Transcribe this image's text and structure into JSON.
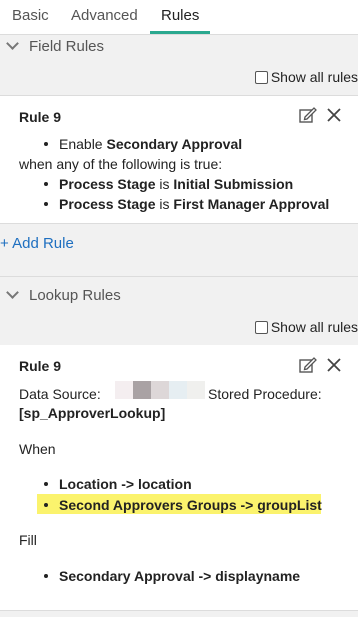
{
  "tabs": [
    {
      "label": "Basic",
      "active": false
    },
    {
      "label": "Advanced",
      "active": false
    },
    {
      "label": "Rules",
      "active": true
    }
  ],
  "field_rules": {
    "header": "Field Rules",
    "show_all_label": "Show all rules",
    "show_all_checked": false,
    "rule": {
      "title": "Rule 9",
      "action_verb": "Enable",
      "action_target": "Secondary Approval",
      "condition_intro": "when any of the following is true:",
      "conditions": [
        {
          "field": "Process Stage",
          "op": "is",
          "value": "Initial Submission"
        },
        {
          "field": "Process Stage",
          "op": "is",
          "value": "First Manager Approval"
        }
      ]
    },
    "add_rule_label": "+ Add Rule"
  },
  "lookup_rules": {
    "header": "Lookup Rules",
    "show_all_label": "Show all rules",
    "show_all_checked": false,
    "rule": {
      "title": "Rule 9",
      "data_source_label": "Data Source:",
      "stored_procedure_label": "Stored Procedure:",
      "stored_procedure_value": "[sp_ApproverLookup]",
      "when_label": "When",
      "when_items": [
        {
          "text": "Location -> location",
          "highlighted": false
        },
        {
          "text": "Second Approvers Groups -> groupList",
          "highlighted": true
        }
      ],
      "fill_label": "Fill",
      "fill_items": [
        {
          "text": "Secondary Approval -> displayname"
        }
      ]
    }
  },
  "colors": {
    "accent": "#2aa88f",
    "link": "#1e6fc0",
    "highlight": "#fbf36d",
    "section_bg": "#f1f1f1"
  }
}
